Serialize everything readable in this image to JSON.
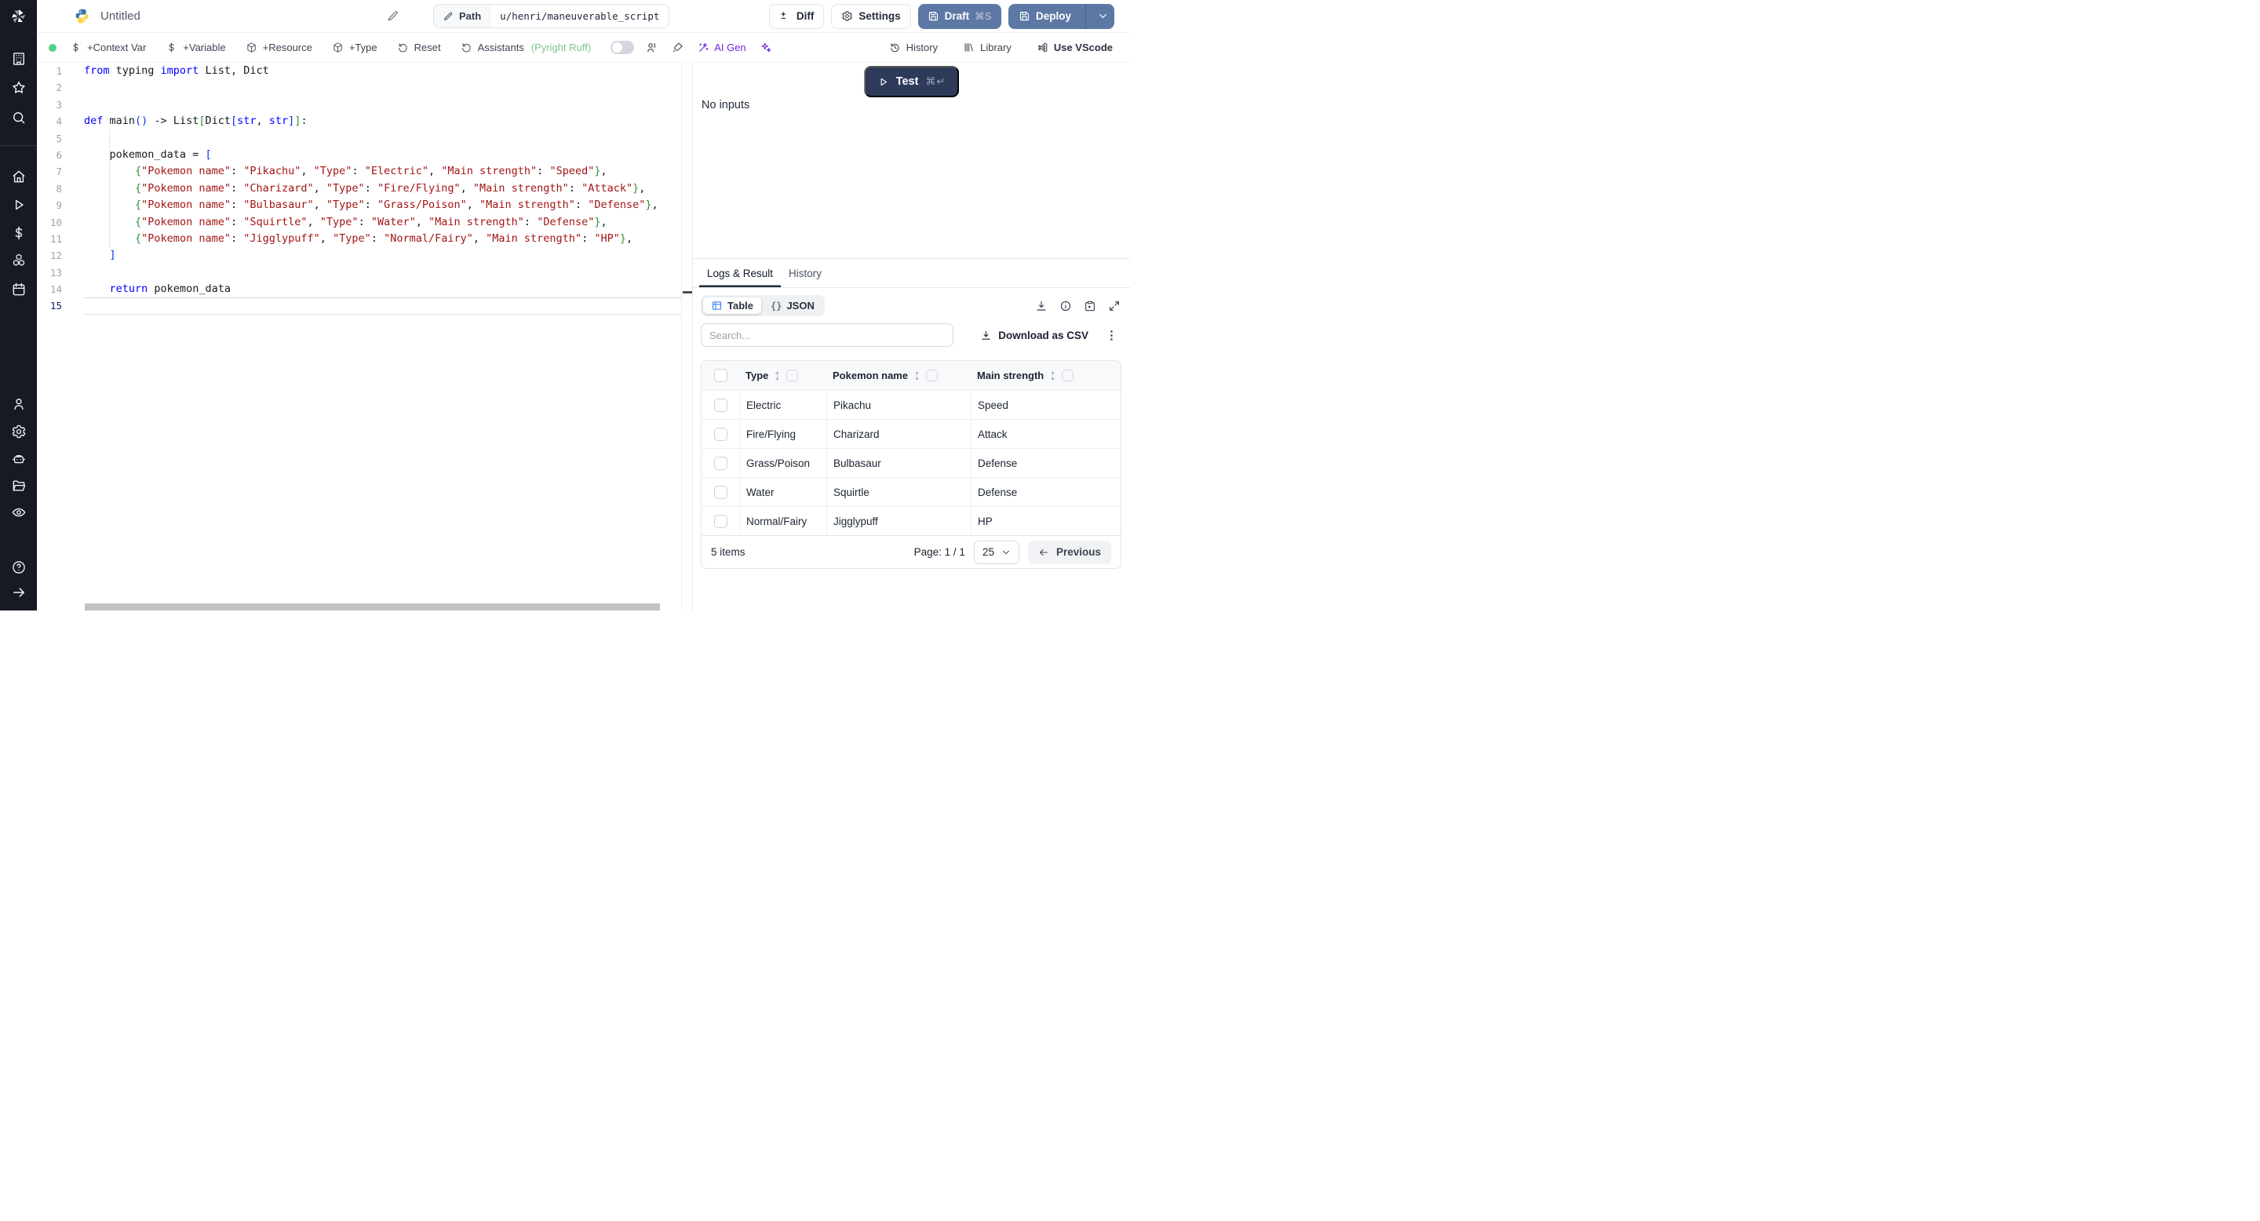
{
  "topbar": {
    "title": "Untitled",
    "path_label": "Path",
    "path_value": "u/henri/maneuverable_script",
    "diff_label": "Diff",
    "settings_label": "Settings",
    "draft_label": "Draft",
    "draft_shortcut": "⌘S",
    "deploy_label": "Deploy"
  },
  "toolbar": {
    "add_context_var": "+Context Var",
    "add_variable": "+Variable",
    "add_resource": "+Resource",
    "add_type": "+Type",
    "reset": "Reset",
    "assistants": "Assistants",
    "assistants_detail": "(Pyright Ruff)",
    "ai_gen": "AI Gen",
    "history": "History",
    "library": "Library",
    "use_vscode": "Use VScode"
  },
  "sidebar": {
    "icon_names": [
      "windmill-logo",
      "building-icon",
      "star-icon",
      "search-icon",
      "home-icon",
      "runs-play-icon",
      "variables-dollar-icon",
      "resources-cubes-icon",
      "schedules-calendar-icon",
      "user-icon",
      "settings-gear-icon",
      "workers-robot-icon",
      "folders-icon",
      "audit-eye-icon",
      "help-icon",
      "expand-arrow-icon"
    ]
  },
  "editor": {
    "current_line": 15,
    "lines": [
      {
        "n": 1,
        "tokens": [
          [
            "k",
            "from"
          ],
          [
            "p",
            " typing "
          ],
          [
            "k",
            "import"
          ],
          [
            "p",
            " List, Dict"
          ]
        ]
      },
      {
        "n": 2,
        "tokens": []
      },
      {
        "n": 3,
        "tokens": []
      },
      {
        "n": 4,
        "tokens": [
          [
            "k",
            "def"
          ],
          [
            "p",
            " main"
          ],
          [
            "b",
            "()"
          ],
          [
            "p",
            " -> List"
          ],
          [
            "g",
            "["
          ],
          [
            "p",
            "Dict"
          ],
          [
            "b",
            "["
          ],
          [
            "k",
            "str"
          ],
          [
            "p",
            ", "
          ],
          [
            "k",
            "str"
          ],
          [
            "b",
            "]"
          ],
          [
            "g",
            "]"
          ],
          [
            "p",
            ":"
          ]
        ]
      },
      {
        "n": 5,
        "tokens": []
      },
      {
        "n": 6,
        "tokens": [
          [
            "p",
            "    pokemon_data = "
          ],
          [
            "b",
            "["
          ]
        ]
      },
      {
        "n": 7,
        "tokens": [
          [
            "p",
            "        "
          ],
          [
            "g",
            "{"
          ],
          [
            "s",
            "\"Pokemon name\""
          ],
          [
            "p",
            ": "
          ],
          [
            "s",
            "\"Pikachu\""
          ],
          [
            "p",
            ", "
          ],
          [
            "s",
            "\"Type\""
          ],
          [
            "p",
            ": "
          ],
          [
            "s",
            "\"Electric\""
          ],
          [
            "p",
            ", "
          ],
          [
            "s",
            "\"Main strength\""
          ],
          [
            "p",
            ": "
          ],
          [
            "s",
            "\"Speed\""
          ],
          [
            "g",
            "}"
          ],
          [
            "p",
            ","
          ]
        ]
      },
      {
        "n": 8,
        "tokens": [
          [
            "p",
            "        "
          ],
          [
            "g",
            "{"
          ],
          [
            "s",
            "\"Pokemon name\""
          ],
          [
            "p",
            ": "
          ],
          [
            "s",
            "\"Charizard\""
          ],
          [
            "p",
            ", "
          ],
          [
            "s",
            "\"Type\""
          ],
          [
            "p",
            ": "
          ],
          [
            "s",
            "\"Fire/Flying\""
          ],
          [
            "p",
            ", "
          ],
          [
            "s",
            "\"Main strength\""
          ],
          [
            "p",
            ": "
          ],
          [
            "s",
            "\"Attack\""
          ],
          [
            "g",
            "}"
          ],
          [
            "p",
            ","
          ]
        ]
      },
      {
        "n": 9,
        "tokens": [
          [
            "p",
            "        "
          ],
          [
            "g",
            "{"
          ],
          [
            "s",
            "\"Pokemon name\""
          ],
          [
            "p",
            ": "
          ],
          [
            "s",
            "\"Bulbasaur\""
          ],
          [
            "p",
            ", "
          ],
          [
            "s",
            "\"Type\""
          ],
          [
            "p",
            ": "
          ],
          [
            "s",
            "\"Grass/Poison\""
          ],
          [
            "p",
            ", "
          ],
          [
            "s",
            "\"Main strength\""
          ],
          [
            "p",
            ": "
          ],
          [
            "s",
            "\"Defense\""
          ],
          [
            "g",
            "}"
          ],
          [
            "p",
            ","
          ]
        ]
      },
      {
        "n": 10,
        "tokens": [
          [
            "p",
            "        "
          ],
          [
            "g",
            "{"
          ],
          [
            "s",
            "\"Pokemon name\""
          ],
          [
            "p",
            ": "
          ],
          [
            "s",
            "\"Squirtle\""
          ],
          [
            "p",
            ", "
          ],
          [
            "s",
            "\"Type\""
          ],
          [
            "p",
            ": "
          ],
          [
            "s",
            "\"Water\""
          ],
          [
            "p",
            ", "
          ],
          [
            "s",
            "\"Main strength\""
          ],
          [
            "p",
            ": "
          ],
          [
            "s",
            "\"Defense\""
          ],
          [
            "g",
            "}"
          ],
          [
            "p",
            ","
          ]
        ]
      },
      {
        "n": 11,
        "tokens": [
          [
            "p",
            "        "
          ],
          [
            "g",
            "{"
          ],
          [
            "s",
            "\"Pokemon name\""
          ],
          [
            "p",
            ": "
          ],
          [
            "s",
            "\"Jigglypuff\""
          ],
          [
            "p",
            ", "
          ],
          [
            "s",
            "\"Type\""
          ],
          [
            "p",
            ": "
          ],
          [
            "s",
            "\"Normal/Fairy\""
          ],
          [
            "p",
            ", "
          ],
          [
            "s",
            "\"Main strength\""
          ],
          [
            "p",
            ": "
          ],
          [
            "s",
            "\"HP\""
          ],
          [
            "g",
            "}"
          ],
          [
            "p",
            ","
          ]
        ]
      },
      {
        "n": 12,
        "tokens": [
          [
            "p",
            "    "
          ],
          [
            "b",
            "]"
          ]
        ]
      },
      {
        "n": 13,
        "tokens": []
      },
      {
        "n": 14,
        "tokens": [
          [
            "p",
            "    "
          ],
          [
            "k",
            "return"
          ],
          [
            "p",
            " pokemon_data"
          ]
        ]
      },
      {
        "n": 15,
        "tokens": []
      }
    ]
  },
  "run_panel": {
    "test_label": "Test",
    "test_shortcut": "⌘↵",
    "no_inputs": "No inputs"
  },
  "result_panel": {
    "tabs": [
      {
        "label": "Logs & Result",
        "active": true
      },
      {
        "label": "History",
        "active": false
      }
    ],
    "view_toggle": [
      {
        "label": "Table",
        "active": true
      },
      {
        "label": "JSON",
        "active": false
      }
    ],
    "json_glyph": "{}",
    "search_placeholder": "Search...",
    "download_csv_label": "Download as CSV",
    "kebab_glyph": "⋮",
    "icon_names": [
      "download-icon",
      "info-icon",
      "copy-clipboard-icon",
      "expand-icon"
    ],
    "table": {
      "columns": [
        "Type",
        "Pokemon name",
        "Main strength"
      ],
      "rows": [
        [
          "Electric",
          "Pikachu",
          "Speed"
        ],
        [
          "Fire/Flying",
          "Charizard",
          "Attack"
        ],
        [
          "Grass/Poison",
          "Bulbasaur",
          "Defense"
        ],
        [
          "Water",
          "Squirtle",
          "Defense"
        ],
        [
          "Normal/Fairy",
          "Jigglypuff",
          "HP"
        ]
      ],
      "items_label": "5 items",
      "page_label": "Page: 1 / 1",
      "page_size": "25",
      "previous_label": "Previous"
    }
  },
  "colors": {
    "rail_dark": "#171a21",
    "action_blue": "#5d78a4",
    "test_navy": "#2d3a5a",
    "ai_purple": "#6d28d9",
    "assistant_green": "#7dc492",
    "status_green": "#55d08c",
    "code_keyword": "#0000ff",
    "code_string": "#a31515",
    "bracket_green": "#319331",
    "bracket_blue": "#0431fa",
    "table_icon_blue": "#3b82f6"
  }
}
